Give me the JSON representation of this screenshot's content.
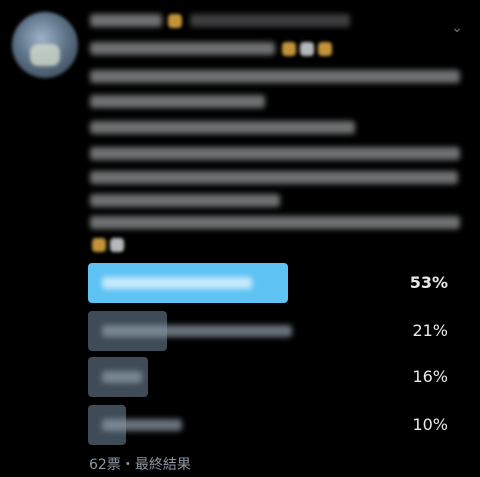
{
  "poll": {
    "options": [
      {
        "percent": "53%",
        "fraction": 0.53,
        "is_winner": true
      },
      {
        "percent": "21%",
        "fraction": 0.21,
        "is_winner": false
      },
      {
        "percent": "16%",
        "fraction": 0.16,
        "is_winner": false
      },
      {
        "percent": "10%",
        "fraction": 0.1,
        "is_winner": false
      }
    ],
    "footer": "62票・最終結果"
  },
  "colors": {
    "winner_bar": "#5ec2f2",
    "other_bar": "#3f4c58",
    "background": "#000000",
    "secondary_text": "#8b98a5"
  },
  "icons": {
    "menu": "chevron-down-icon"
  }
}
